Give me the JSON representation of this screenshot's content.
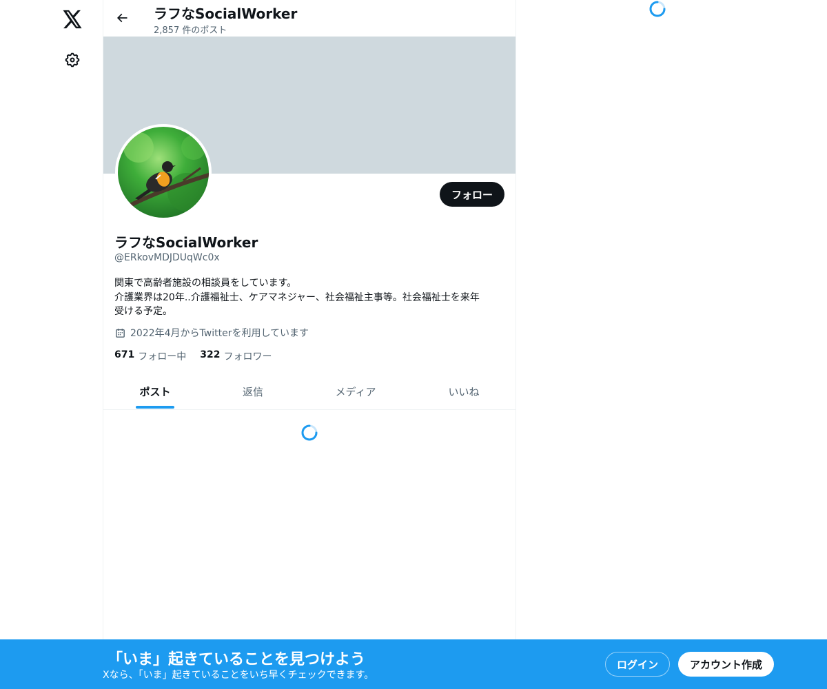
{
  "nav": {
    "logo_icon": "x-logo-icon",
    "settings_icon": "gear-icon"
  },
  "header": {
    "back_icon": "arrow-left-icon",
    "title": "ラフなSocialWorker",
    "post_count": "2,857 件のポスト"
  },
  "profile": {
    "banner_color": "#cfd9de",
    "avatar_description": "bird-photo",
    "follow_label": "フォロー",
    "display_name": "ラフなSocialWorker",
    "handle": "@ERkovMDJDUqWc0x",
    "bio_lines": [
      "関東で高齢者施設の相談員をしています。",
      "介護業界は20年..介護福祉士、ケアマネジャー、社会福祉主事等。社会福祉士を来年",
      "受ける予定。"
    ],
    "calendar_icon": "calendar-icon",
    "joined": "2022年4月からTwitterを利用しています",
    "following_count": "671",
    "following_label": "フォロー中",
    "followers_count": "322",
    "followers_label": "フォロワー"
  },
  "tabs": [
    {
      "label": "ポスト",
      "active": true
    },
    {
      "label": "返信",
      "active": false
    },
    {
      "label": "メディア",
      "active": false
    },
    {
      "label": "いいね",
      "active": false
    }
  ],
  "bottom_bar": {
    "title": "「いま」起きていることを見つけよう",
    "subtitle": "Xなら、「いま」起きていることをいち早くチェックできます。",
    "login_label": "ログイン",
    "signup_label": "アカウント作成"
  },
  "colors": {
    "accent": "#1d9bf0",
    "text_primary": "#0f1419",
    "text_secondary": "#536471"
  }
}
